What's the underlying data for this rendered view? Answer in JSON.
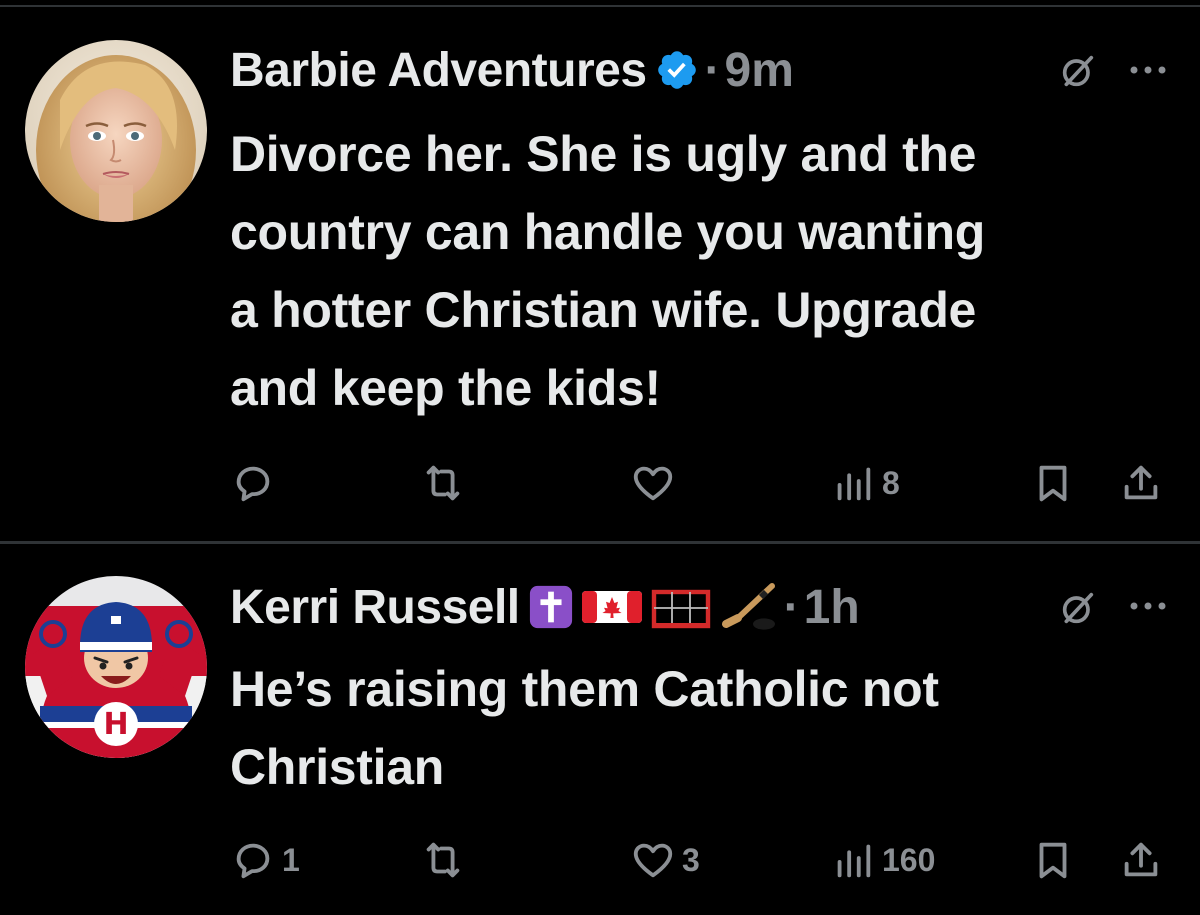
{
  "colors": {
    "background": "#000000",
    "text": "#e7e9ea",
    "secondary": "#8b8f94",
    "divider": "#2f3336",
    "verified": "#1d9bf0"
  },
  "tweets": [
    {
      "author": "Barbie Adventures",
      "verified": true,
      "separator": "·",
      "time": "9m",
      "avatar_icon": "profile-photo-woman",
      "body_lines": [
        "Divorce her. She is ugly and the",
        "country can handle you wanting",
        "a hotter Christian wife. Upgrade",
        "and keep the kids!"
      ],
      "actions": {
        "replies": "",
        "reposts": "",
        "likes": "",
        "views": "8"
      }
    },
    {
      "author": "Kerri Russell",
      "verified": false,
      "name_emojis": [
        "latin-cross-emoji",
        "canada-flag-emoji",
        "goal-net-emoji",
        "hockey-stick-emoji"
      ],
      "separator": "·",
      "time": "1h",
      "avatar_icon": "hockey-player-cartoon",
      "body_lines": [
        "He’s raising them Catholic not",
        "Christian"
      ],
      "actions": {
        "replies": "1",
        "reposts": "",
        "likes": "3",
        "views": "160"
      }
    }
  ]
}
